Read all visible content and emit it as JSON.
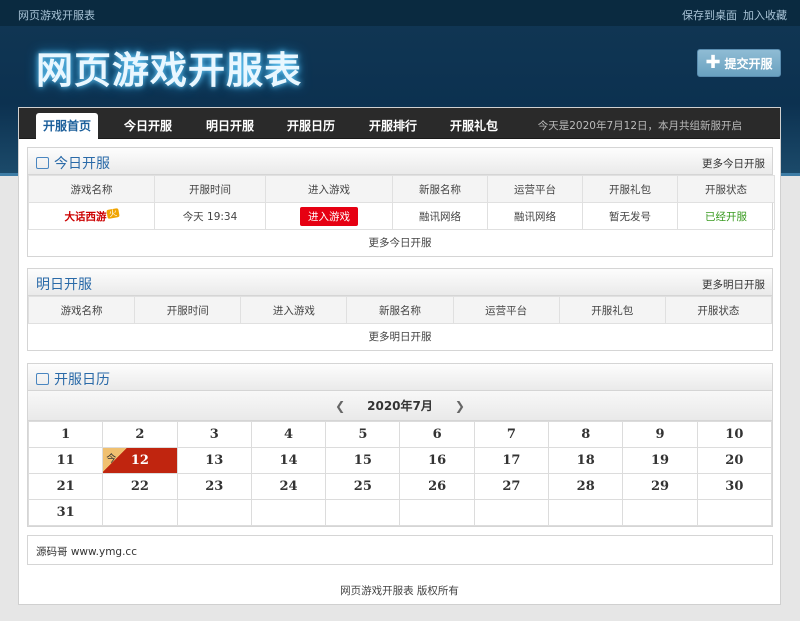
{
  "header": {
    "site_link": "网页游戏开服表",
    "save_desktop": "保存到桌面",
    "bookmark": "加入收藏",
    "logo": "网页游戏开服表",
    "submit_button": "提交开服"
  },
  "nav": {
    "items": [
      "开服首页",
      "今日开服",
      "明日开服",
      "开服日历",
      "开服排行",
      "开服礼包"
    ],
    "date_text": "今天是2020年7月12日，本月共组新服开启"
  },
  "today": {
    "title": "今日开服",
    "more": "更多今日开服",
    "columns": [
      "游戏名称",
      "开服时间",
      "进入游戏",
      "新服名称",
      "运营平台",
      "开服礼包",
      "开服状态"
    ],
    "row": {
      "game": "大话西游",
      "game_tag": "火",
      "time": "今天 19:34",
      "enter": "进入游戏",
      "server": "融讯网络",
      "platform": "融讯网络",
      "gift": "暂无发号",
      "status": "已经开服"
    },
    "footer": "更多今日开服"
  },
  "tomorrow": {
    "title": "明日开服",
    "more": "更多明日开服",
    "columns": [
      "游戏名称",
      "开服时间",
      "进入游戏",
      "新服名称",
      "运营平台",
      "开服礼包",
      "开服状态"
    ],
    "footer": "更多明日开服"
  },
  "calendar": {
    "title": "开服日历",
    "month": "2020年7月",
    "today_day": 12,
    "today_label": "今",
    "weeks": [
      [
        "1",
        "2",
        "3",
        "4",
        "5",
        "6",
        "7",
        "8",
        "9",
        "10"
      ],
      [
        "11",
        "12",
        "13",
        "14",
        "15",
        "16",
        "17",
        "18",
        "19",
        "20"
      ],
      [
        "21",
        "22",
        "23",
        "24",
        "25",
        "26",
        "27",
        "28",
        "29",
        "30"
      ],
      [
        "31",
        "",
        "",
        "",
        "",
        "",
        "",
        "",
        "",
        ""
      ]
    ]
  },
  "credit": "源码哥 www.ymg.cc",
  "copyright": "网页游戏开服表 版权所有",
  "colors": {
    "accent": "#2a6aa8",
    "header_bg": "#113754",
    "today_cell": "#c0250f",
    "enter_button": "#e60012",
    "status_open": "#3a9b21"
  }
}
